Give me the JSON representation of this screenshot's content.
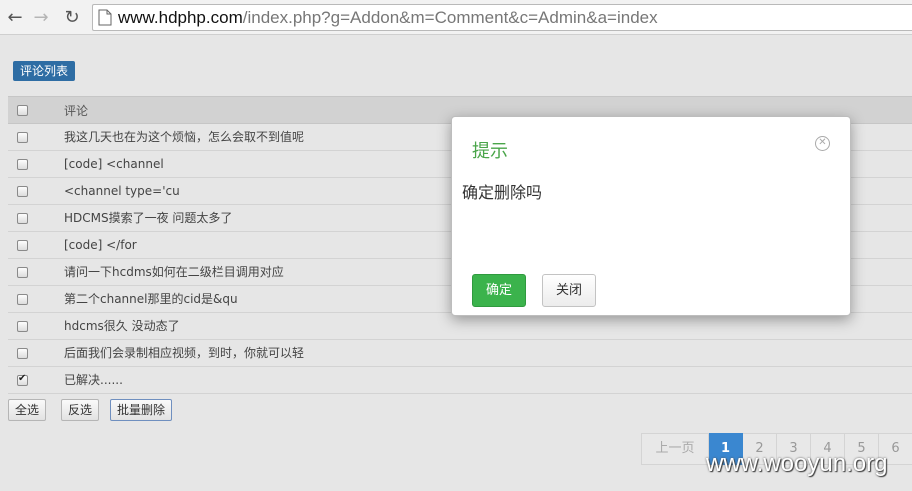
{
  "browser": {
    "url_host": "www.hdphp.com",
    "url_path": "/index.php?g=Addon&m=Comment&c=Admin&a=index"
  },
  "page": {
    "tab_label": "评论列表",
    "table": {
      "header": "评论",
      "rows": [
        {
          "text": "我这几天也在为这个烦恼，怎么会取不到值呢",
          "checked": false
        },
        {
          "text": "[code] <channel",
          "checked": false
        },
        {
          "text": "<channel type='cu",
          "checked": false
        },
        {
          "text": "HDCMS摸索了一夜 问题太多了",
          "checked": false
        },
        {
          "text": "[code] </for",
          "checked": false
        },
        {
          "text": "请问一下hcdms如何在二级栏目调用对应",
          "checked": false
        },
        {
          "text": "第二个channel那里的cid是&qu",
          "checked": false
        },
        {
          "text": "hdcms很久 没动态了",
          "checked": false
        },
        {
          "text": "后面我们会录制相应视频，到时，你就可以轻",
          "checked": false
        },
        {
          "text": "已解决......",
          "checked": true
        }
      ]
    },
    "actions": {
      "select_all": "全选",
      "invert": "反选",
      "batch_delete": "批量删除"
    },
    "pager": {
      "prev": "上一页",
      "pages": [
        "1",
        "2",
        "3",
        "4",
        "5",
        "6"
      ],
      "current": "1"
    },
    "watermark": "www.wooyun.org"
  },
  "modal": {
    "title": "提示",
    "message": "确定删除吗",
    "ok_label": "确定",
    "close_label": "关闭"
  },
  "colors": {
    "tab_blue": "#2e6da4",
    "modal_title_green": "#4aa54a",
    "ok_button_green": "#3bb34c",
    "pager_active": "#3a87d0"
  }
}
